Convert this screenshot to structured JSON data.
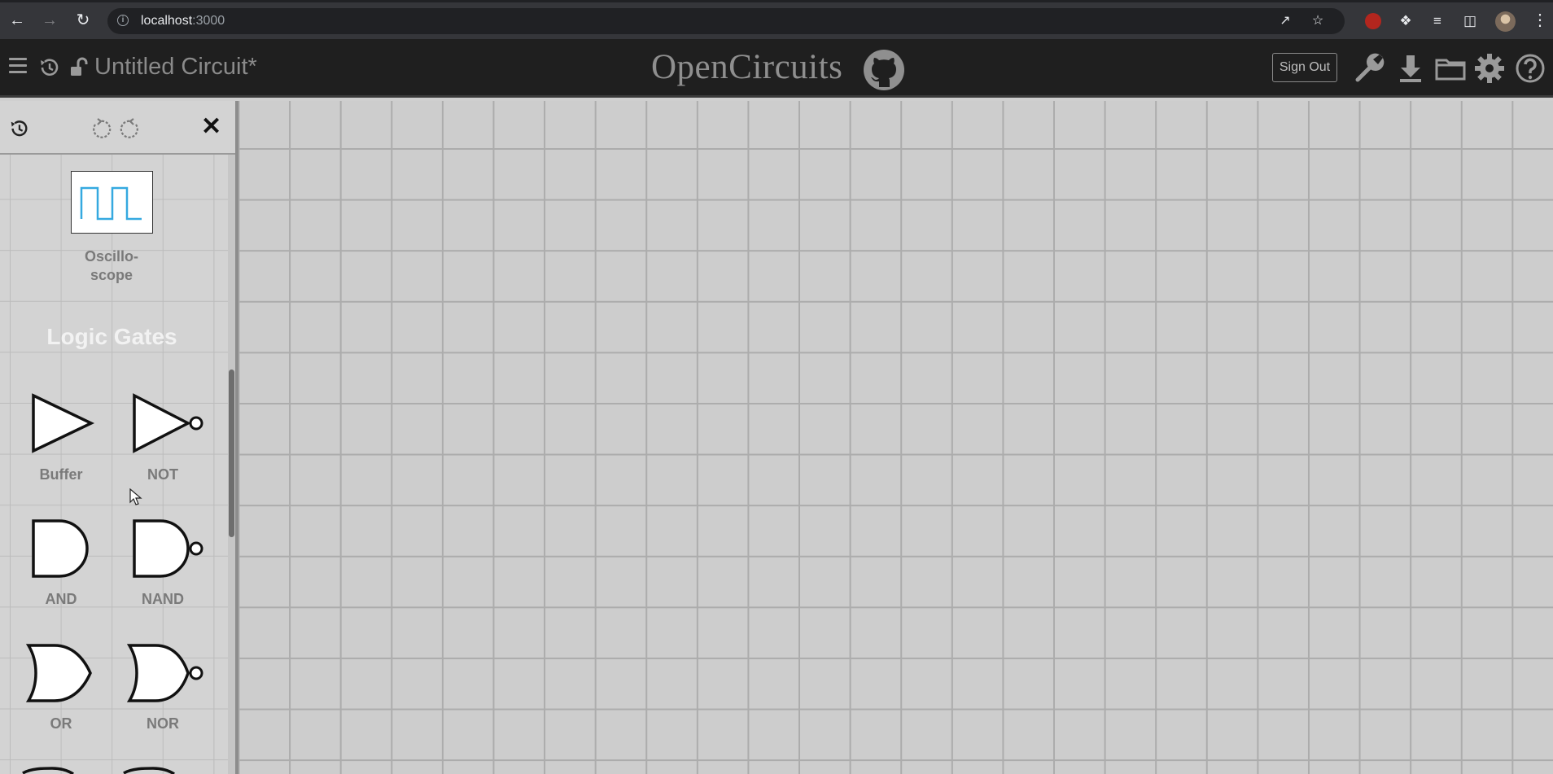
{
  "browser": {
    "url_host": "localhost",
    "url_port": ":3000",
    "back_icon": "arrow-left-icon",
    "forward_icon": "arrow-right-icon",
    "reload_icon": "reload-icon"
  },
  "header": {
    "circuit_title": "Untitled Circuit*",
    "brand": "OpenCircuits",
    "sign_out_label": "Sign Out"
  },
  "history_panel": {
    "close_label": "✕"
  },
  "items": {
    "oscilloscope_label_line1": "Oscillo-",
    "oscilloscope_label_line2": "scope",
    "section_title": "Logic Gates",
    "gates": [
      {
        "label": "Buffer"
      },
      {
        "label": "NOT"
      },
      {
        "label": "AND"
      },
      {
        "label": "NAND"
      },
      {
        "label": "OR"
      },
      {
        "label": "NOR"
      }
    ]
  },
  "colors": {
    "header_bg": "#1f1f1f",
    "canvas_bg": "#cdcdcd",
    "grid_line": "#acacac",
    "oscilloscope_wave": "#35a9e0"
  }
}
